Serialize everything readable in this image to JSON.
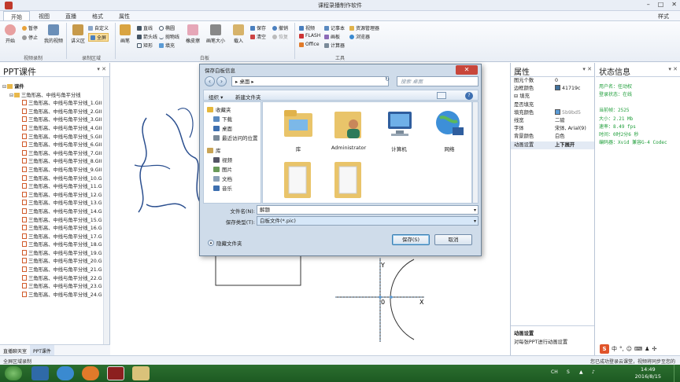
{
  "window": {
    "title": "课程录播制作软件",
    "min": "–",
    "max": "□",
    "close": "✕"
  },
  "tabs": [
    "开始",
    "视图",
    "直播",
    "格式",
    "属性"
  ],
  "style_label": "样式",
  "ribbon": {
    "record": {
      "start": "开始",
      "pause": "暂停",
      "stop": "停止",
      "my_video": "我的视频",
      "group": "视频录制"
    },
    "area": {
      "lecture": "讲义区",
      "custom": "自定义",
      "fullscreen": "全屏",
      "group": "录制区域"
    },
    "board": {
      "pen": "画笔",
      "line": "直线",
      "ellipse": "椭圆",
      "arrow_line": "箭头线",
      "rect": "矩形",
      "parabola": "抛物线",
      "fill": "填充",
      "eraser": "橡皮擦",
      "pen_size": "画笔大小",
      "insert": "载入",
      "save": "保存",
      "clear": "清空",
      "undo": "撤销",
      "redo": "恢复",
      "group": "白板"
    },
    "tools": {
      "video": "视频",
      "flash": "FLASH",
      "office": "Office",
      "notepad": "记事本",
      "drawing": "画板",
      "calculator": "计算器",
      "resource_mgr": "资源管理器",
      "browser": "浏览器",
      "group": "工具"
    }
  },
  "left_panel": {
    "title": "PPT课件",
    "tree": {
      "root": "课件",
      "folder": "三角形高、中线与角平分线",
      "file_prefix": "三角形高、中线与角平分线_",
      "files": [
        "1.GII",
        "2.GII",
        "3.GII",
        "4.GII",
        "5.GII",
        "6.GII",
        "7.GII",
        "8.GII",
        "9.GII",
        "10.G",
        "11.G",
        "12.G",
        "13.G",
        "14.G",
        "15.G",
        "16.G",
        "17.G",
        "18.G",
        "19.G",
        "20.G",
        "21.G",
        "22.G",
        "23.G",
        "24.G"
      ]
    },
    "bottom_tabs": [
      "直播聊天室",
      "PPT课件"
    ]
  },
  "dialog": {
    "title": "保存白板信息",
    "address": "桌面",
    "search_placeholder": "搜索 桌面",
    "toolbar": {
      "organize": "组织 ▾",
      "new_folder": "新建文件夹"
    },
    "nav": [
      "收藏夹",
      "下载",
      "桌面",
      "最近访问的位置",
      "库",
      "视频",
      "图片",
      "文档",
      "音乐"
    ],
    "files": [
      "库",
      "Administrator",
      "计算机",
      "网络",
      "",
      ""
    ],
    "filename_label": "文件名(N):",
    "filename_value": "解题",
    "filetype_label": "保存类型(T):",
    "filetype_value": "白板文件(*.pic)",
    "hide_folders": "隐藏文件夹",
    "save_button": "保存(S)",
    "cancel_button": "取消"
  },
  "properties": {
    "title": "属性",
    "rows": [
      {
        "k": "图元个数",
        "v": "0"
      },
      {
        "k": "边框颜色",
        "v": "41719c"
      },
      {
        "k": "⊟  填充",
        "v": ""
      },
      {
        "k": "    是否填充",
        "v": ""
      },
      {
        "k": "    填充颜色",
        "v": "5b9bd5"
      },
      {
        "k": "线宽",
        "v": "二磅"
      },
      {
        "k": "字体",
        "v": "宋体, Arial(9)"
      },
      {
        "k": "背景颜色",
        "v": "白色"
      },
      {
        "k": "动画设置",
        "v": "上下展开"
      }
    ],
    "border_color": "#41719c",
    "fill_color": "#5b9bd5",
    "desc_title": "动画设置",
    "desc_text": "对每张PPT进行动画设置"
  },
  "status_info": {
    "title": "状态信息",
    "lines": [
      "用户名：任动权",
      "登录状态：在线",
      "当前帧：2525",
      "大小：2.21 Mb",
      "速率：8.49 fps",
      "时间：0时2分6 秒",
      "编码器：Xvid 兼容G-4 Codec"
    ]
  },
  "app_status": {
    "left": "全屏区域录制",
    "right": "您已成功登录云课堂，视频将同步至您的"
  },
  "taskbar": {
    "time": "14:49",
    "date": "2016/8/15",
    "tray": "CH"
  },
  "colors": {
    "accent": "#3d6fb0",
    "taskbar": "#236328",
    "status_text": "#1f9e3a"
  }
}
